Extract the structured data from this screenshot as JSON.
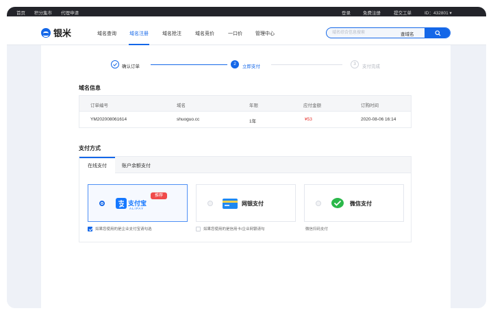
{
  "topbar": {
    "left_links": [
      "首页",
      "积分集市",
      "代理申请"
    ],
    "right_links": [
      "登录",
      "免费注册",
      "提交工单"
    ],
    "account_id": "ID：432801 ▾"
  },
  "brand": {
    "name": "银米",
    "accent": "#1467e8"
  },
  "nav": {
    "items": [
      "域名查询",
      "域名注册",
      "域名抢注",
      "域名竞价",
      "一口价",
      "管理中心"
    ],
    "active_index": 1
  },
  "search": {
    "placeholder": "域名综合信息搜索",
    "type_label": "查域名",
    "button_icon": "search-icon"
  },
  "steps": [
    {
      "label": "确认订单",
      "status": "done",
      "icon": "check-icon"
    },
    {
      "label": "立即支付",
      "status": "current",
      "number": "2"
    },
    {
      "label": "支付完成",
      "status": "pending",
      "number": "3"
    }
  ],
  "domain_info": {
    "title": "域名信息",
    "headers": [
      "订单编号",
      "域名",
      "年限",
      "应付金额",
      "订购时间"
    ],
    "row": [
      "YM202008061614",
      "shuoguo.cc",
      "1年",
      "¥53",
      "2020-08-06 16:14"
    ]
  },
  "payment": {
    "title": "支付方式",
    "tabs": [
      "在线支付",
      "账户余额支付"
    ],
    "active_tab": 0,
    "options": [
      {
        "name": "支付宝",
        "sub": "ALIPAY",
        "badge": "推荐",
        "selected": true,
        "icon": "alipay-icon"
      },
      {
        "name": "网银支付",
        "selected": false,
        "icon": "bank-card-icon"
      },
      {
        "name": "微信支付",
        "selected": false,
        "icon": "wechat-pay-icon"
      }
    ],
    "notes": [
      {
        "text": "如果您使用的是企业支付宝请勾选",
        "checked": true
      },
      {
        "text": "如果您使用的是信用卡/企业网银请勾",
        "checked": false
      },
      {
        "text": "微信扫码支付"
      }
    ]
  },
  "colors": {
    "price": "#e5322d",
    "badge": "#f04a4a",
    "wechat": "#2bb84a",
    "alipay": "#1678ff"
  }
}
